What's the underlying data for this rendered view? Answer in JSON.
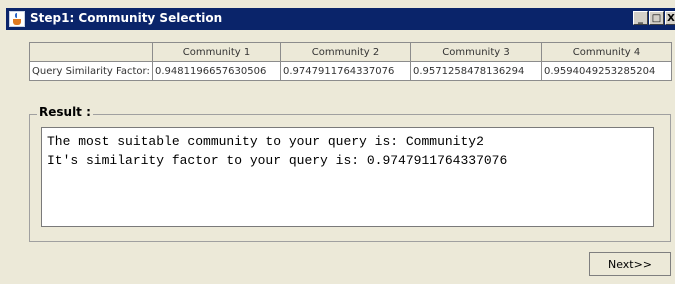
{
  "window": {
    "title": "Step1: Community Selection",
    "buttons": {
      "minimize": "_",
      "maximize": "□",
      "close": "X"
    }
  },
  "similarity_table": {
    "columns": [
      "",
      "Community 1",
      "Community 2",
      "Community 3",
      "Community 4"
    ],
    "row_label": "Query Similarity Factor:",
    "values": [
      "0.9481196657630506",
      "0.9747911764337076",
      "0.9571258478136294",
      "0.9594049253285204"
    ]
  },
  "result": {
    "title": "Result :",
    "lines": [
      "The most suitable community to your query is: Community2",
      "It's similarity factor to your query is: 0.9747911764337076"
    ]
  },
  "footer": {
    "next_label": "Next>>"
  },
  "colors": {
    "title_bar": "#0a246a",
    "background": "#ece9d8",
    "cell": "#ffffff"
  }
}
